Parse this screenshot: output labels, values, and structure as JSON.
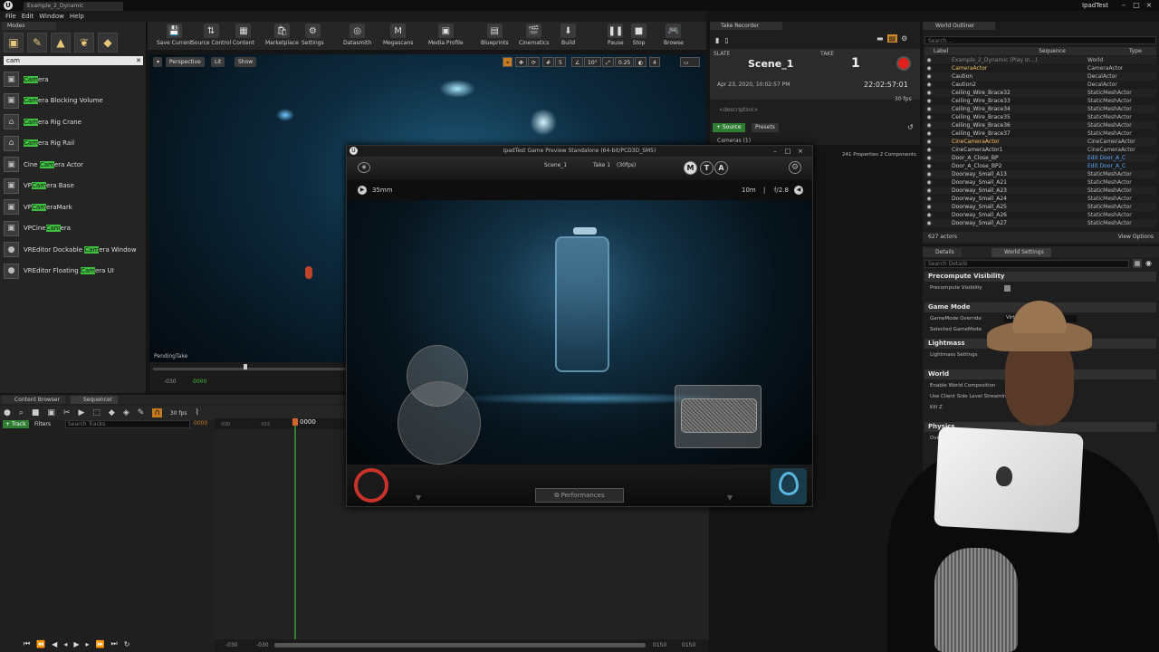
{
  "window": {
    "doc_tab": "Example_2_Dynamic",
    "user": "IpadTest",
    "controls": [
      "–",
      "□",
      "×"
    ]
  },
  "menu": [
    "File",
    "Edit",
    "Window",
    "Help"
  ],
  "modes": {
    "tab": "Modes",
    "search_value": "cam",
    "items": [
      {
        "pre": "",
        "match": "Cam",
        "post": "era"
      },
      {
        "pre": "",
        "match": "Cam",
        "post": "era Blocking Volume"
      },
      {
        "pre": "",
        "match": "Cam",
        "post": "era Rig Crane"
      },
      {
        "pre": "",
        "match": "Cam",
        "post": "era Rig Rail"
      },
      {
        "pre": "Cine ",
        "match": "Cam",
        "post": "era Actor"
      },
      {
        "pre": "VP",
        "match": "Cam",
        "post": "era Base"
      },
      {
        "pre": "VP",
        "match": "Cam",
        "post": "eraMark"
      },
      {
        "pre": "VPCine",
        "match": "Cam",
        "post": "era"
      },
      {
        "pre": "VREditor Dockable ",
        "match": "Cam",
        "post": "era Window"
      },
      {
        "pre": "VREditor Floating ",
        "match": "Cam",
        "post": "era UI"
      }
    ]
  },
  "toolbar": [
    {
      "label": "Save Current",
      "icon": "💾"
    },
    {
      "label": "Source Control",
      "icon": "⇅"
    },
    {
      "label": "Content",
      "icon": "▦"
    },
    {
      "label": "Marketplace",
      "icon": "🛍"
    },
    {
      "label": "Settings",
      "icon": "⚙"
    },
    {
      "label": "Datasmith",
      "icon": "◎"
    },
    {
      "label": "Megascans",
      "icon": "M"
    },
    {
      "label": "Media Profile",
      "icon": "▣"
    },
    {
      "label": "Blueprints",
      "icon": "▤"
    },
    {
      "label": "Cinematics",
      "icon": "🎬"
    },
    {
      "label": "Build",
      "icon": "⬇"
    },
    {
      "label": "Pause",
      "icon": "❚❚"
    },
    {
      "label": "Stop",
      "icon": "■"
    },
    {
      "label": "Browse",
      "icon": "🎮"
    }
  ],
  "viewport": {
    "perspective": "Perspective",
    "lit": "Lit",
    "show": "Show",
    "snap_grid": "5",
    "snap_angle": "10°",
    "snap_scale": "0.25",
    "cam_speed": "4",
    "pending": "PendingTake",
    "tick_left": "-030",
    "tick_green": "0000"
  },
  "take_recorder": {
    "tab": "Take Recorder",
    "slate_label": "SLATE",
    "take_label": "TAKE",
    "slate": "Scene_1",
    "take": "1",
    "date": "Apr 23, 2020, 10:02:57 PM",
    "timecode": "22:02:57:01",
    "fps": "30 fps",
    "description": "<description>",
    "source_btn": "+ Source",
    "presets_btn": "Presets",
    "cameras": "Cameras (1)",
    "props_info": "241 Properties 2 Components"
  },
  "outliner": {
    "tab": "World Outliner",
    "search_placeholder": "Search...",
    "col_label": "Label",
    "col_sequence": "Sequence",
    "col_type": "Type",
    "rows": [
      {
        "name": "Example_2_Dynamic (Play In...)",
        "type": "World",
        "dim": true
      },
      {
        "name": "CameraActor",
        "type": "CameraActor",
        "hl": true
      },
      {
        "name": "Caution",
        "type": "DecalActor"
      },
      {
        "name": "Caution2",
        "type": "DecalActor"
      },
      {
        "name": "Ceiling_Wire_Brace32",
        "type": "StaticMeshActor"
      },
      {
        "name": "Ceiling_Wire_Brace33",
        "type": "StaticMeshActor"
      },
      {
        "name": "Ceiling_Wire_Brace34",
        "type": "StaticMeshActor"
      },
      {
        "name": "Ceiling_Wire_Brace35",
        "type": "StaticMeshActor"
      },
      {
        "name": "Ceiling_Wire_Brace36",
        "type": "StaticMeshActor"
      },
      {
        "name": "Ceiling_Wire_Brace37",
        "type": "StaticMeshActor"
      },
      {
        "name": "CineCameraActor",
        "type": "CineCameraActor",
        "hl": true
      },
      {
        "name": "CineCameraActor1",
        "type": "CineCameraActor"
      },
      {
        "name": "Door_A_Close_BP",
        "type": "Edit Door_A_C",
        "link": true
      },
      {
        "name": "Door_A_Close_BP2",
        "type": "Edit Door_A_C",
        "link": true
      },
      {
        "name": "Doorway_Small_A13",
        "type": "StaticMeshActor"
      },
      {
        "name": "Doorway_Small_A21",
        "type": "StaticMeshActor"
      },
      {
        "name": "Doorway_Small_A23",
        "type": "StaticMeshActor"
      },
      {
        "name": "Doorway_Small_A24",
        "type": "StaticMeshActor"
      },
      {
        "name": "Doorway_Small_A25",
        "type": "StaticMeshActor"
      },
      {
        "name": "Doorway_Small_A26",
        "type": "StaticMeshActor"
      },
      {
        "name": "Doorway_Small_A27",
        "type": "StaticMeshActor"
      }
    ],
    "count": "627 actors",
    "view_options": "View Options"
  },
  "details": {
    "tab_details": "Details",
    "tab_world": "World Settings",
    "search_placeholder": "Search Details",
    "sections": [
      {
        "title": "Precompute Visibility",
        "props": [
          "Precompute Visibility"
        ]
      },
      {
        "title": "Game Mode",
        "props": [
          "GameMode Override",
          "Selected GameMode"
        ]
      },
      {
        "title": "Lightmass",
        "props": [
          "Lightmass Settings"
        ]
      },
      {
        "title": "World",
        "props": [
          "Enable World Composition",
          "Use Client Side Level Streaming V",
          "Kill Z"
        ]
      },
      {
        "title": "Physics",
        "props": [
          "Ove"
        ]
      }
    ],
    "gamemode_value": "Virt"
  },
  "sequencer": {
    "tab_cb": "Content Browser",
    "tab_seq": "Sequencer",
    "fps": "30 fps",
    "track_btn": "+ Track",
    "filters_btn": "Filters",
    "search_placeholder": "Search Tracks",
    "frame_green": "0000",
    "frame_current": "0000",
    "ruler_ticks": [
      "-030",
      "-015"
    ],
    "bottom_left": "-030",
    "bottom_left2": "-030",
    "bottom_right": "0150",
    "bottom_right2": "0150"
  },
  "preview": {
    "title": "IpadTest Game Preview Standalone (64-bit/PCD3D_SM5)",
    "scene": "Scene_1",
    "take": "Take 1",
    "fps": "(30fps)",
    "m_btn": "M",
    "t_btn": "T",
    "a_btn": "A",
    "lens": "35mm",
    "distance": "10m",
    "aperture": "f/2.8",
    "performances": "Performances"
  }
}
